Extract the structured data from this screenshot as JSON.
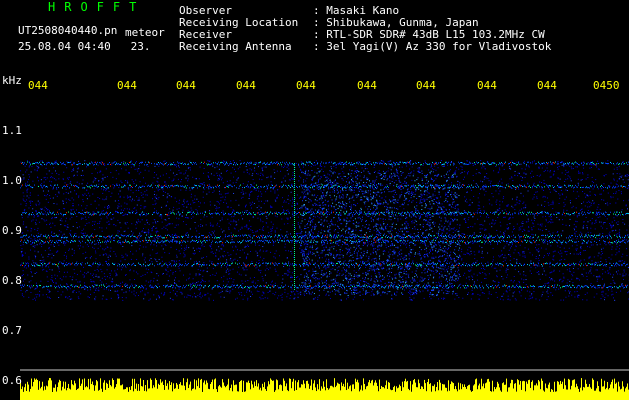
{
  "header": {
    "title": "HROFFT",
    "filename": "UT2508040440.pn",
    "meteor_label": "meteor",
    "date_time": "25.08.04 04:40",
    "count": "23."
  },
  "station": {
    "rows": [
      {
        "label": "Observer",
        "value": ": Masaki Kano"
      },
      {
        "label": "Receiving Location",
        "value": ": Shibukawa, Gunma, Japan"
      },
      {
        "label": "Receiver",
        "value": ": RTL-SDR SDR# 43dB L15 103.2MHz CW"
      },
      {
        "label": "Receiving Antenna",
        "value": ": 3el Yagi(V) Az 330 for Vladivostok"
      }
    ]
  },
  "axis": {
    "y_unit": "kHz",
    "y_ticks": [
      "1.1",
      "1.0",
      "0.9",
      "0.8",
      "0.7",
      "0.6"
    ],
    "x_ticks": [
      "044",
      "044",
      "044",
      "044",
      "044",
      "044",
      "044",
      "044",
      "044",
      "0450"
    ]
  },
  "colors": {
    "background": "#000000",
    "noise": "#0000ff",
    "signal": "#00ffff",
    "strong": "#ff0000",
    "level_bar": "#ffff00",
    "text": "#ffffff",
    "accent": "#ffff00",
    "title": "#00ff00"
  }
}
